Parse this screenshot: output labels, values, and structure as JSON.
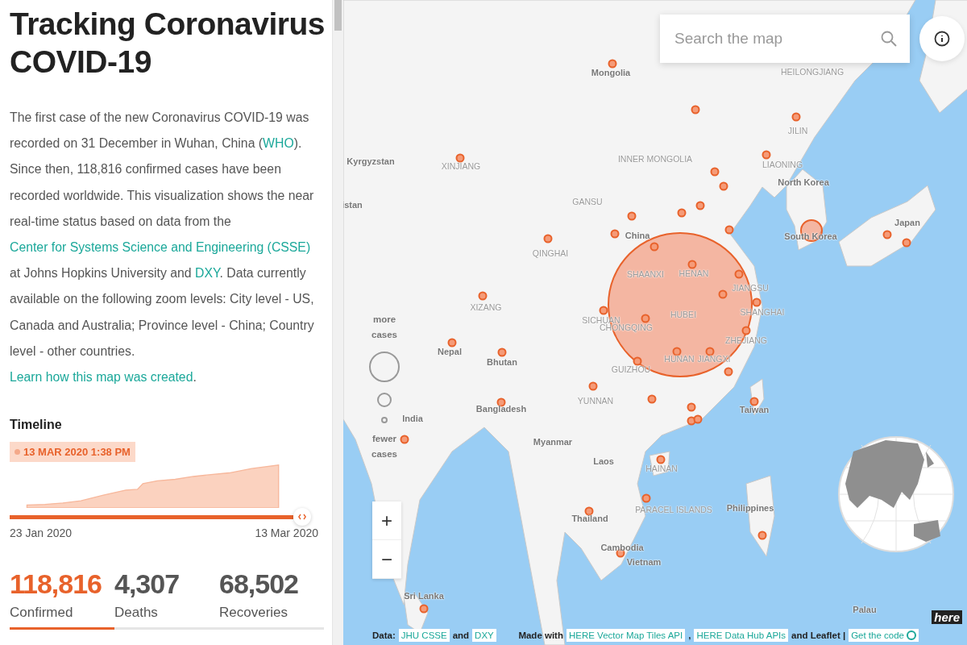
{
  "sidebar": {
    "title": "Tracking Coronavirus COVID-19",
    "intro": [
      {
        "kind": "text",
        "text": "The first case of the new Coronavirus COVID-19 was recorded on 31 December in Wuhan, China ("
      },
      {
        "kind": "link",
        "text": "WHO"
      },
      {
        "kind": "text",
        "text": "). Since then, 118,816 confirmed cases have been recorded worldwide. This visualization shows the near real-time status based on data from the "
      },
      {
        "kind": "link",
        "text": "Center for Systems Science and Engineering (CSSE)"
      },
      {
        "kind": "text",
        "text": " at Johns Hopkins University and "
      },
      {
        "kind": "link",
        "text": "DXY"
      },
      {
        "kind": "text",
        "text": ". Data currently available on the following zoom levels: City level - US, Canada and Australia; Province level - China; Country level - other countries. "
      },
      {
        "kind": "link",
        "text": "Learn how this map was created"
      },
      {
        "kind": "text",
        "text": "."
      }
    ],
    "timeline": {
      "heading": "Timeline",
      "current": "13 MAR 2020 1:38 PM",
      "level": 1,
      "start": "23 Jan 2020",
      "end": "13 Mar 2020"
    },
    "stats": [
      {
        "value": "118,816",
        "label": "Confirmed",
        "selected": true
      },
      {
        "value": "4,307",
        "label": "Deaths",
        "selected": false
      },
      {
        "value": "68,502",
        "label": "Recoveries",
        "selected": false
      }
    ]
  },
  "map": {
    "search": {
      "placeholder": "Search the map"
    },
    "legend": {
      "top": "more cases",
      "bottom": "fewer cases"
    },
    "zoom": [
      "+",
      "−"
    ],
    "labels": [
      "Mongolia",
      "HEILONGJIANG",
      "JILIN",
      "Kyrgyzstan",
      "XINJIANG",
      "INNER MONGOLIA",
      "LIAONING",
      "North Korea",
      "istan",
      "GANSU",
      "China",
      "QINGHAI",
      "South Korea",
      "Japan",
      "SHAANXI",
      "HENAN",
      "JIANGSU",
      "SICHUAN",
      "HUBEI",
      "SHANGHAI",
      "CHONGQING",
      "ZHEJIANG",
      "XIZANG",
      "HUNAN",
      "JIANGXI",
      "Nepal",
      "Bhutan",
      "GUIZHOU",
      "YUNNAN",
      "Bangladesh",
      "Taiwan",
      "India",
      "Myanmar",
      "Laos",
      "HAINAN",
      "Philippines",
      "PARACEL ISLANDS",
      "Thailand",
      "Cambodia",
      "Vietnam",
      "Sri Lanka",
      "Palau"
    ],
    "footer": {
      "data_parts": [
        {
          "kind": "text",
          "text": "Data:"
        },
        {
          "kind": "link",
          "text": "JHU CSSE"
        },
        {
          "kind": "text",
          "text": "and"
        },
        {
          "kind": "link",
          "text": "DXY"
        }
      ],
      "made_parts": [
        {
          "kind": "text",
          "text": "Made with"
        },
        {
          "kind": "link",
          "text": "HERE Vector Map Tiles API"
        },
        {
          "kind": "text",
          "text": ","
        },
        {
          "kind": "link",
          "text": "HERE Data Hub APIs"
        },
        {
          "kind": "text",
          "text": "and Leaflet |"
        },
        {
          "kind": "code",
          "text": "Get the code"
        }
      ]
    },
    "logo": "here"
  }
}
